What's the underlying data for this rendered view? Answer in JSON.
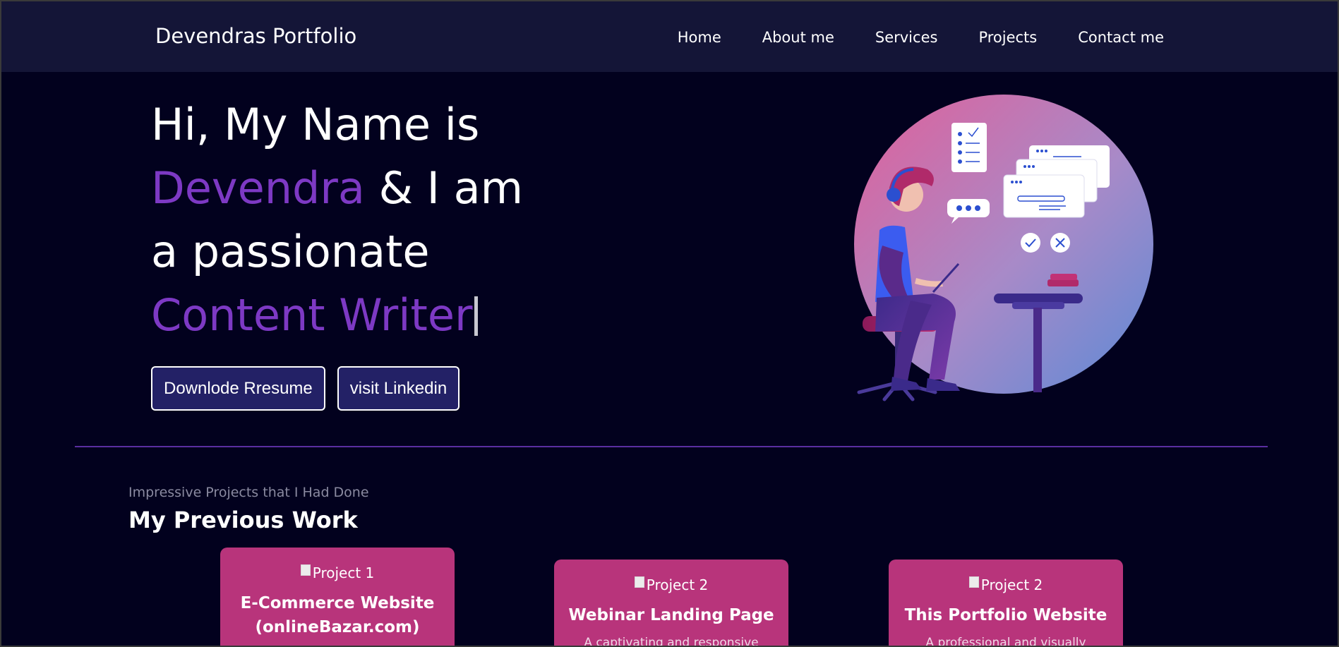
{
  "brand": "Devendras Portfolio",
  "nav": {
    "home": "Home",
    "about": "About me",
    "services": "Services",
    "projects": "Projects",
    "contact": "Contact me"
  },
  "hero": {
    "line1": "Hi, My Name is",
    "name": "Devendra",
    "line2_rest": " & I am",
    "line3": "a passionate",
    "role": "Content Writer"
  },
  "buttons": {
    "resume": "Downlode Rresume",
    "linkedin": "visit Linkedin"
  },
  "work": {
    "subtitle": "Impressive Projects that I Had Done",
    "title": "My Previous Work"
  },
  "projects": [
    {
      "img_alt": "Project 1",
      "title": "E-Commerce Website (onlineBazar.com)",
      "desc": ""
    },
    {
      "img_alt": "Project 2",
      "title": "Webinar Landing Page",
      "desc": "A captivating and responsive"
    },
    {
      "img_alt": "Project 2",
      "title": "This Portfolio Website",
      "desc": "A professional and visually"
    }
  ],
  "colors": {
    "background": "#02011e",
    "navbar": "#141537",
    "accent": "#7d39c4",
    "button": "#232166",
    "card": "#b8347b"
  },
  "icons": {
    "illustration": "person-working-on-laptop-illustration",
    "broken_image": "broken-image-icon"
  }
}
